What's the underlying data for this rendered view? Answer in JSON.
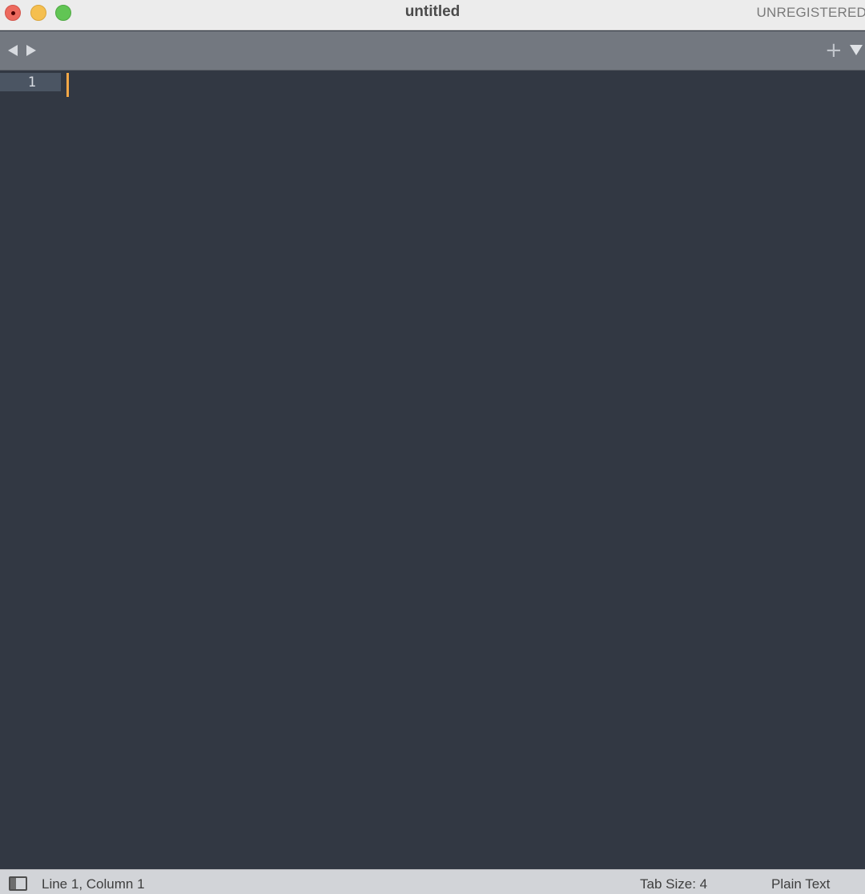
{
  "window": {
    "title": "untitled",
    "registration_label": "UNREGISTERED"
  },
  "tabbar": {
    "back_icon": "triangle-left-icon",
    "forward_icon": "triangle-right-icon",
    "new_tab_glyph": "+",
    "menu_icon": "triangle-down-icon"
  },
  "editor": {
    "line_numbers": [
      "1"
    ],
    "content": "",
    "caret_color": "#f5a846",
    "background_color": "#323843"
  },
  "statusbar": {
    "position": "Line 1, Column 1",
    "tab_size": "Tab Size: 4",
    "syntax": "Plain Text"
  }
}
